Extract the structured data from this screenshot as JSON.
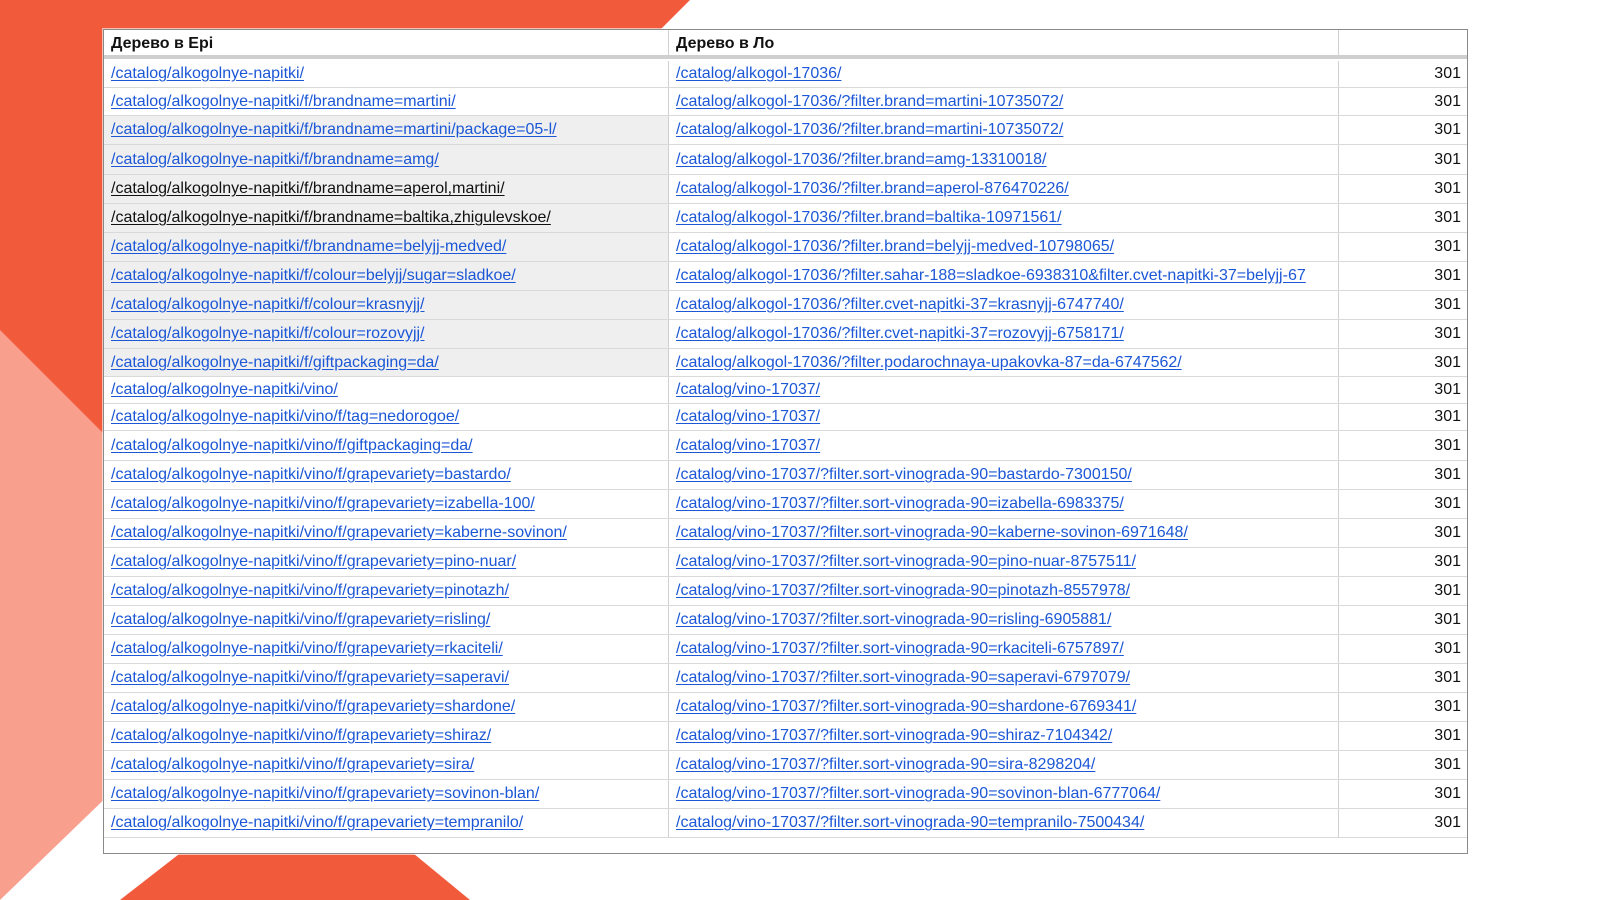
{
  "colors": {
    "accent": "#f25a3c",
    "link": "#1b57d6",
    "header_rule": "#cfcfcf"
  },
  "table": {
    "headers": [
      "Дерево в Epi",
      "Дерево в Ло",
      ""
    ],
    "rows": [
      {
        "from": "/catalog/alkogolnye-napitki/",
        "to": "/catalog/alkogol-17036/",
        "code": "301"
      },
      {
        "from": "/catalog/alkogolnye-napitki/f/brandname=martini/",
        "to": "/catalog/alkogol-17036/?filter.brand=martini-10735072/",
        "code": "301"
      },
      {
        "from": "/catalog/alkogolnye-napitki/f/brandname=martini/package=05-l/",
        "to": "/catalog/alkogol-17036/?filter.brand=martini-10735072/",
        "code": "301"
      },
      {
        "from": "/catalog/alkogolnye-napitki/f/brandname=amg/",
        "to": "/catalog/alkogol-17036/?filter.brand=amg-13310018/",
        "code": "301"
      },
      {
        "from": "/catalog/alkogolnye-napitki/f/brandname=aperol,martini/",
        "to": "/catalog/alkogol-17036/?filter.brand=aperol-876470226/",
        "code": "301"
      },
      {
        "from": "/catalog/alkogolnye-napitki/f/brandname=baltika,zhigulevskoe/",
        "to": "/catalog/alkogol-17036/?filter.brand=baltika-10971561/",
        "code": "301"
      },
      {
        "from": "/catalog/alkogolnye-napitki/f/brandname=belyjj-medved/",
        "to": "/catalog/alkogol-17036/?filter.brand=belyjj-medved-10798065/",
        "code": "301"
      },
      {
        "from": "/catalog/alkogolnye-napitki/f/colour=belyjj/sugar=sladkoe/",
        "to": "/catalog/alkogol-17036/?filter.sahar-188=sladkoe-6938310&filter.cvet-napitki-37=belyjj-67",
        "code": "301"
      },
      {
        "from": "/catalog/alkogolnye-napitki/f/colour=krasnyjj/",
        "to": "/catalog/alkogol-17036/?filter.cvet-napitki-37=krasnyjj-6747740/",
        "code": "301"
      },
      {
        "from": "/catalog/alkogolnye-napitki/f/colour=rozovyjj/",
        "to": "/catalog/alkogol-17036/?filter.cvet-napitki-37=rozovyjj-6758171/",
        "code": "301"
      },
      {
        "from": "/catalog/alkogolnye-napitki/f/giftpackaging=da/",
        "to": "/catalog/alkogol-17036/?filter.podarochnaya-upakovka-87=da-6747562/",
        "code": "301"
      },
      {
        "from": "/catalog/alkogolnye-napitki/vino/",
        "to": "/catalog/vino-17037/",
        "code": "301"
      },
      {
        "from": "/catalog/alkogolnye-napitki/vino/f/tag=nedorogoe/",
        "to": "/catalog/vino-17037/",
        "code": "301"
      },
      {
        "from": "/catalog/alkogolnye-napitki/vino/f/giftpackaging=da/",
        "to": "/catalog/vino-17037/",
        "code": "301"
      },
      {
        "from": "/catalog/alkogolnye-napitki/vino/f/grapevariety=bastardo/",
        "to": "/catalog/vino-17037/?filter.sort-vinograda-90=bastardo-7300150/",
        "code": "301"
      },
      {
        "from": "/catalog/alkogolnye-napitki/vino/f/grapevariety=izabella-100/",
        "to": "/catalog/vino-17037/?filter.sort-vinograda-90=izabella-6983375/",
        "code": "301"
      },
      {
        "from": "/catalog/alkogolnye-napitki/vino/f/grapevariety=kaberne-sovinon/",
        "to": "/catalog/vino-17037/?filter.sort-vinograda-90=kaberne-sovinon-6971648/",
        "code": "301"
      },
      {
        "from": "/catalog/alkogolnye-napitki/vino/f/grapevariety=pino-nuar/",
        "to": "/catalog/vino-17037/?filter.sort-vinograda-90=pino-nuar-8757511/",
        "code": "301"
      },
      {
        "from": "/catalog/alkogolnye-napitki/vino/f/grapevariety=pinotazh/",
        "to": "/catalog/vino-17037/?filter.sort-vinograda-90=pinotazh-8557978/",
        "code": "301"
      },
      {
        "from": "/catalog/alkogolnye-napitki/vino/f/grapevariety=risling/",
        "to": "/catalog/vino-17037/?filter.sort-vinograda-90=risling-6905881/",
        "code": "301"
      },
      {
        "from": "/catalog/alkogolnye-napitki/vino/f/grapevariety=rkaciteli/",
        "to": "/catalog/vino-17037/?filter.sort-vinograda-90=rkaciteli-6757897/",
        "code": "301"
      },
      {
        "from": "/catalog/alkogolnye-napitki/vino/f/grapevariety=saperavi/",
        "to": "/catalog/vino-17037/?filter.sort-vinograda-90=saperavi-6797079/",
        "code": "301"
      },
      {
        "from": "/catalog/alkogolnye-napitki/vino/f/grapevariety=shardone/",
        "to": "/catalog/vino-17037/?filter.sort-vinograda-90=shardone-6769341/",
        "code": "301"
      },
      {
        "from": "/catalog/alkogolnye-napitki/vino/f/grapevariety=shiraz/",
        "to": "/catalog/vino-17037/?filter.sort-vinograda-90=shiraz-7104342/",
        "code": "301"
      },
      {
        "from": "/catalog/alkogolnye-napitki/vino/f/grapevariety=sira/",
        "to": "/catalog/vino-17037/?filter.sort-vinograda-90=sira-8298204/",
        "code": "301"
      },
      {
        "from": "/catalog/alkogolnye-napitki/vino/f/grapevariety=sovinon-blan/",
        "to": "/catalog/vino-17037/?filter.sort-vinograda-90=sovinon-blan-6777064/",
        "code": "301"
      },
      {
        "from": "/catalog/alkogolnye-napitki/vino/f/grapevariety=tempranilo/",
        "to": "/catalog/vino-17037/?filter.sort-vinograda-90=tempranilo-7500434/",
        "code": "301"
      }
    ]
  }
}
